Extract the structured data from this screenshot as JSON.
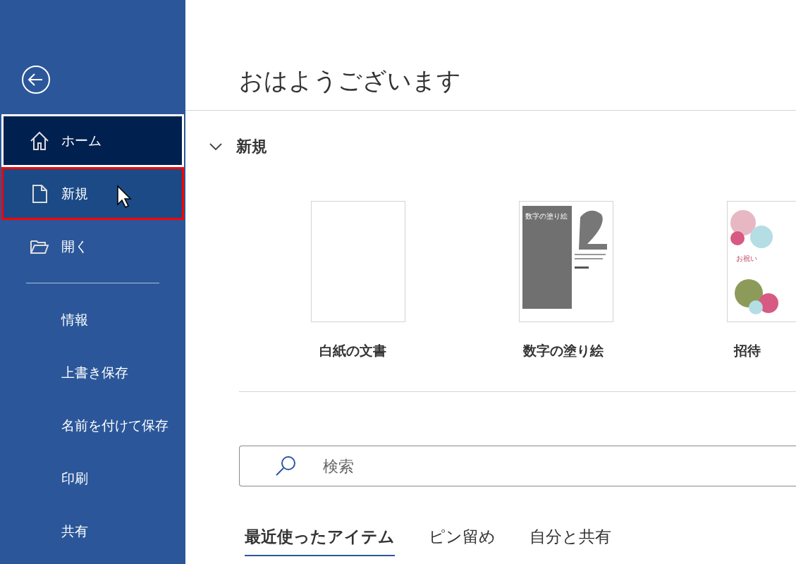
{
  "sidebar": {
    "items": [
      {
        "label": "ホーム",
        "kind": "home",
        "selected": true,
        "highlighted": false
      },
      {
        "label": "新規",
        "kind": "document",
        "selected": false,
        "highlighted": true
      },
      {
        "label": "開く",
        "kind": "folder",
        "selected": false,
        "highlighted": false
      },
      {
        "kind": "divider"
      },
      {
        "label": "情報",
        "kind": "plain",
        "selected": false,
        "highlighted": false
      },
      {
        "label": "上書き保存",
        "kind": "plain",
        "selected": false,
        "highlighted": false
      },
      {
        "label": "名前を付けて保存",
        "kind": "plain",
        "selected": false,
        "highlighted": false
      },
      {
        "label": "印刷",
        "kind": "plain",
        "selected": false,
        "highlighted": false
      },
      {
        "label": "共有",
        "kind": "plain",
        "selected": false,
        "highlighted": false
      }
    ]
  },
  "greeting": "おはようございます",
  "new_section": {
    "title": "新規",
    "expanded": true,
    "templates": [
      {
        "label": "白紙の文書",
        "kind": "blank"
      },
      {
        "label": "数字の塗り絵",
        "kind": "coloring",
        "preview_title": "数字の塗り絵"
      },
      {
        "label": "招待",
        "kind": "floral",
        "preview_title": "お祝い"
      }
    ]
  },
  "search": {
    "placeholder": "検索"
  },
  "tabs": [
    {
      "label": "最近使ったアイテム",
      "selected": true
    },
    {
      "label": "ピン留め",
      "selected": false
    },
    {
      "label": "自分と共有",
      "selected": false
    }
  ]
}
